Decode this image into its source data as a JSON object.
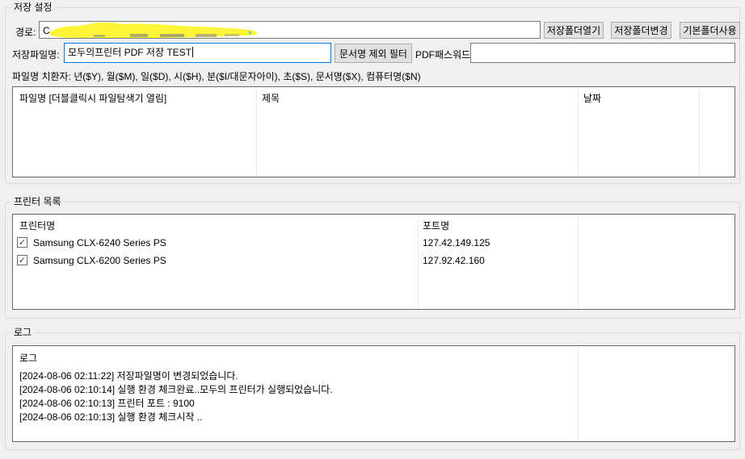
{
  "colors": {
    "background": "#f0f0f0",
    "focus_border": "#0078d7",
    "button_bg": "#e1e1e1",
    "highlight_marker": "#fdf337"
  },
  "save_settings": {
    "title": "저장 설정",
    "path_label": "경로:",
    "path_visible_text": "C",
    "path_redacted_note": "redacted-with-yellow-marker",
    "buttons": {
      "open_save_folder": "저장폴더열기",
      "change_save_folder": "저장폴더변경",
      "use_default_folder": "기본폴더사용"
    },
    "filename_label": "저장파일명:",
    "filename_value": "모두의프린터 PDF 저장 TEST",
    "doc_name_filter_button": "문서명 제외 필터",
    "pdf_password_label": "PDF패스워드:",
    "pdf_password_value": "",
    "placeholder_hint": "파일명 치환자: 년($Y), 월($M), 일($D), 시($H), 분($I/대문자아이), 초($S), 문서명($X), 컴퓨터명($N)",
    "file_list": {
      "columns": [
        "파일명 [더블클릭시 파일탐색기 열림]",
        "제목",
        "날짜"
      ],
      "rows": []
    }
  },
  "printer_section": {
    "title": "프린터 목록",
    "columns": [
      "프린터명",
      "포트명"
    ],
    "check_glyph": "✓",
    "printers": [
      {
        "checked": true,
        "name": "Samsung CLX-6240 Series PS",
        "port": "127.42.149.125"
      },
      {
        "checked": true,
        "name": "Samsung CLX-6200 Series PS",
        "port": "127.92.42.160"
      }
    ]
  },
  "log_section": {
    "title": "로그",
    "list_header": "로그",
    "entries": [
      "[2024-08-06 02:11:22] 저장파일명이 변경되었습니다.",
      "[2024-08-06 02:10:14] 실행 환경 체크완료..모두의 프린터가 실행되었습니다.",
      "[2024-08-06 02:10:13] 프린터 포트 : 9100",
      "[2024-08-06 02:10:13] 실행 환경 체크시작 .."
    ]
  }
}
